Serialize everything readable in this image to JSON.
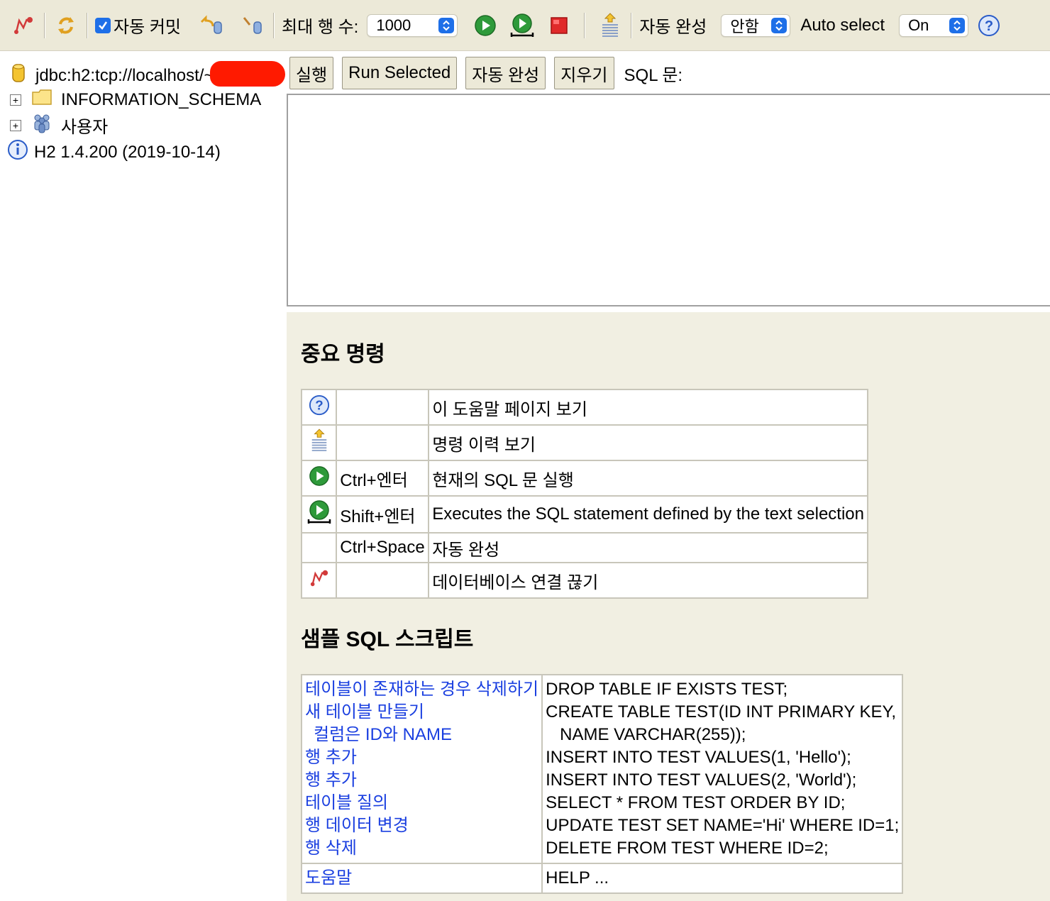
{
  "toolbar": {
    "auto_commit_label": "자동 커밋",
    "max_rows_label": "최대 행 수:",
    "max_rows_value": "1000",
    "autocomplete_label": "자동 완성",
    "autocomplete_value": "안함",
    "auto_select_label": "Auto select",
    "auto_select_value": "On"
  },
  "tree": {
    "connection": "jdbc:h2:tcp://localhost/~",
    "items": [
      {
        "label": "INFORMATION_SCHEMA"
      },
      {
        "label": "사용자"
      }
    ],
    "version": "H2 1.4.200 (2019-10-14)"
  },
  "query_bar": {
    "run_label": "실행",
    "run_selected_label": "Run Selected",
    "autocomplete_label": "자동 완성",
    "clear_label": "지우기",
    "sql_label": "SQL 문:"
  },
  "help": {
    "commands_title": "중요 명령",
    "commands": [
      {
        "icon": "help-icon",
        "key": "",
        "desc": "이 도움말 페이지 보기"
      },
      {
        "icon": "history-icon",
        "key": "",
        "desc": "명령 이력 보기"
      },
      {
        "icon": "run-icon",
        "key": "Ctrl+엔터",
        "desc": "현재의 SQL 문 실행"
      },
      {
        "icon": "run-selected-icon",
        "key": "Shift+엔터",
        "desc": "Executes the SQL statement defined by the text selection"
      },
      {
        "icon": "",
        "key": "Ctrl+Space",
        "desc": "자동 완성"
      },
      {
        "icon": "disconnect-icon",
        "key": "",
        "desc": "데이터베이스 연결 끊기"
      }
    ],
    "sample_title": "샘플 SQL 스크립트",
    "sample_links": [
      "테이블이 존재하는 경우 삭제하기",
      "새 테이블 만들기",
      "  컬럼은 ID와 NAME",
      "행 추가",
      "행 추가",
      "테이블 질의",
      "행 데이터 변경",
      "행 삭제"
    ],
    "sample_sql": [
      "DROP TABLE IF EXISTS TEST;",
      "CREATE TABLE TEST(ID INT PRIMARY KEY,",
      "   NAME VARCHAR(255));",
      "INSERT INTO TEST VALUES(1, 'Hello');",
      "INSERT INTO TEST VALUES(2, 'World');",
      "SELECT * FROM TEST ORDER BY ID;",
      "UPDATE TEST SET NAME='Hi' WHERE ID=1;",
      "DELETE FROM TEST WHERE ID=2;"
    ],
    "help_link": "도움말",
    "help_sql": "HELP ..."
  }
}
